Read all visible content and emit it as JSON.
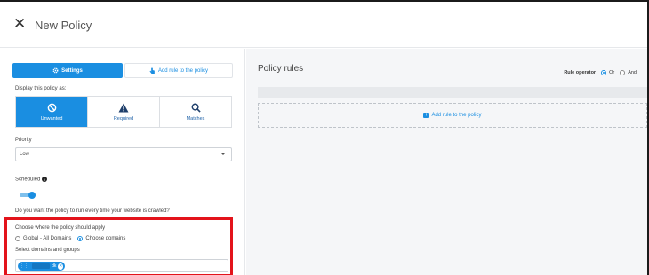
{
  "header": {
    "close_icon": "✕",
    "title": "New Policy"
  },
  "tabs": {
    "settings_label": "Settings",
    "add_rule_label": "Add rule to the policy"
  },
  "display": {
    "label": "Display this policy as:",
    "options": [
      {
        "label": "Unwanted",
        "icon": "ban-icon",
        "active": true
      },
      {
        "label": "Required",
        "icon": "warning-icon",
        "active": false
      },
      {
        "label": "Matches",
        "icon": "search-icon",
        "active": false
      }
    ]
  },
  "priority": {
    "label": "Priority",
    "value": "Low"
  },
  "scheduled": {
    "label": "Scheduled",
    "question": "Do you want the policy to run every time your website is crawled?",
    "enabled": true
  },
  "apply": {
    "label": "Choose where the policy should apply",
    "option_global": "Global - All Domains",
    "option_choose": "Choose domains",
    "selected": "Choose domains",
    "domains_label": "Select domains and groups",
    "chip_suffix": "dk"
  },
  "rules": {
    "title": "Policy rules",
    "operator_label": "Rule operator",
    "operator_or": "Or",
    "operator_and": "And",
    "operator_selected": "Or",
    "add_rule_label": "Add rule to the policy"
  },
  "colors": {
    "accent": "#1a8ee1",
    "highlight": "#e3131b"
  }
}
